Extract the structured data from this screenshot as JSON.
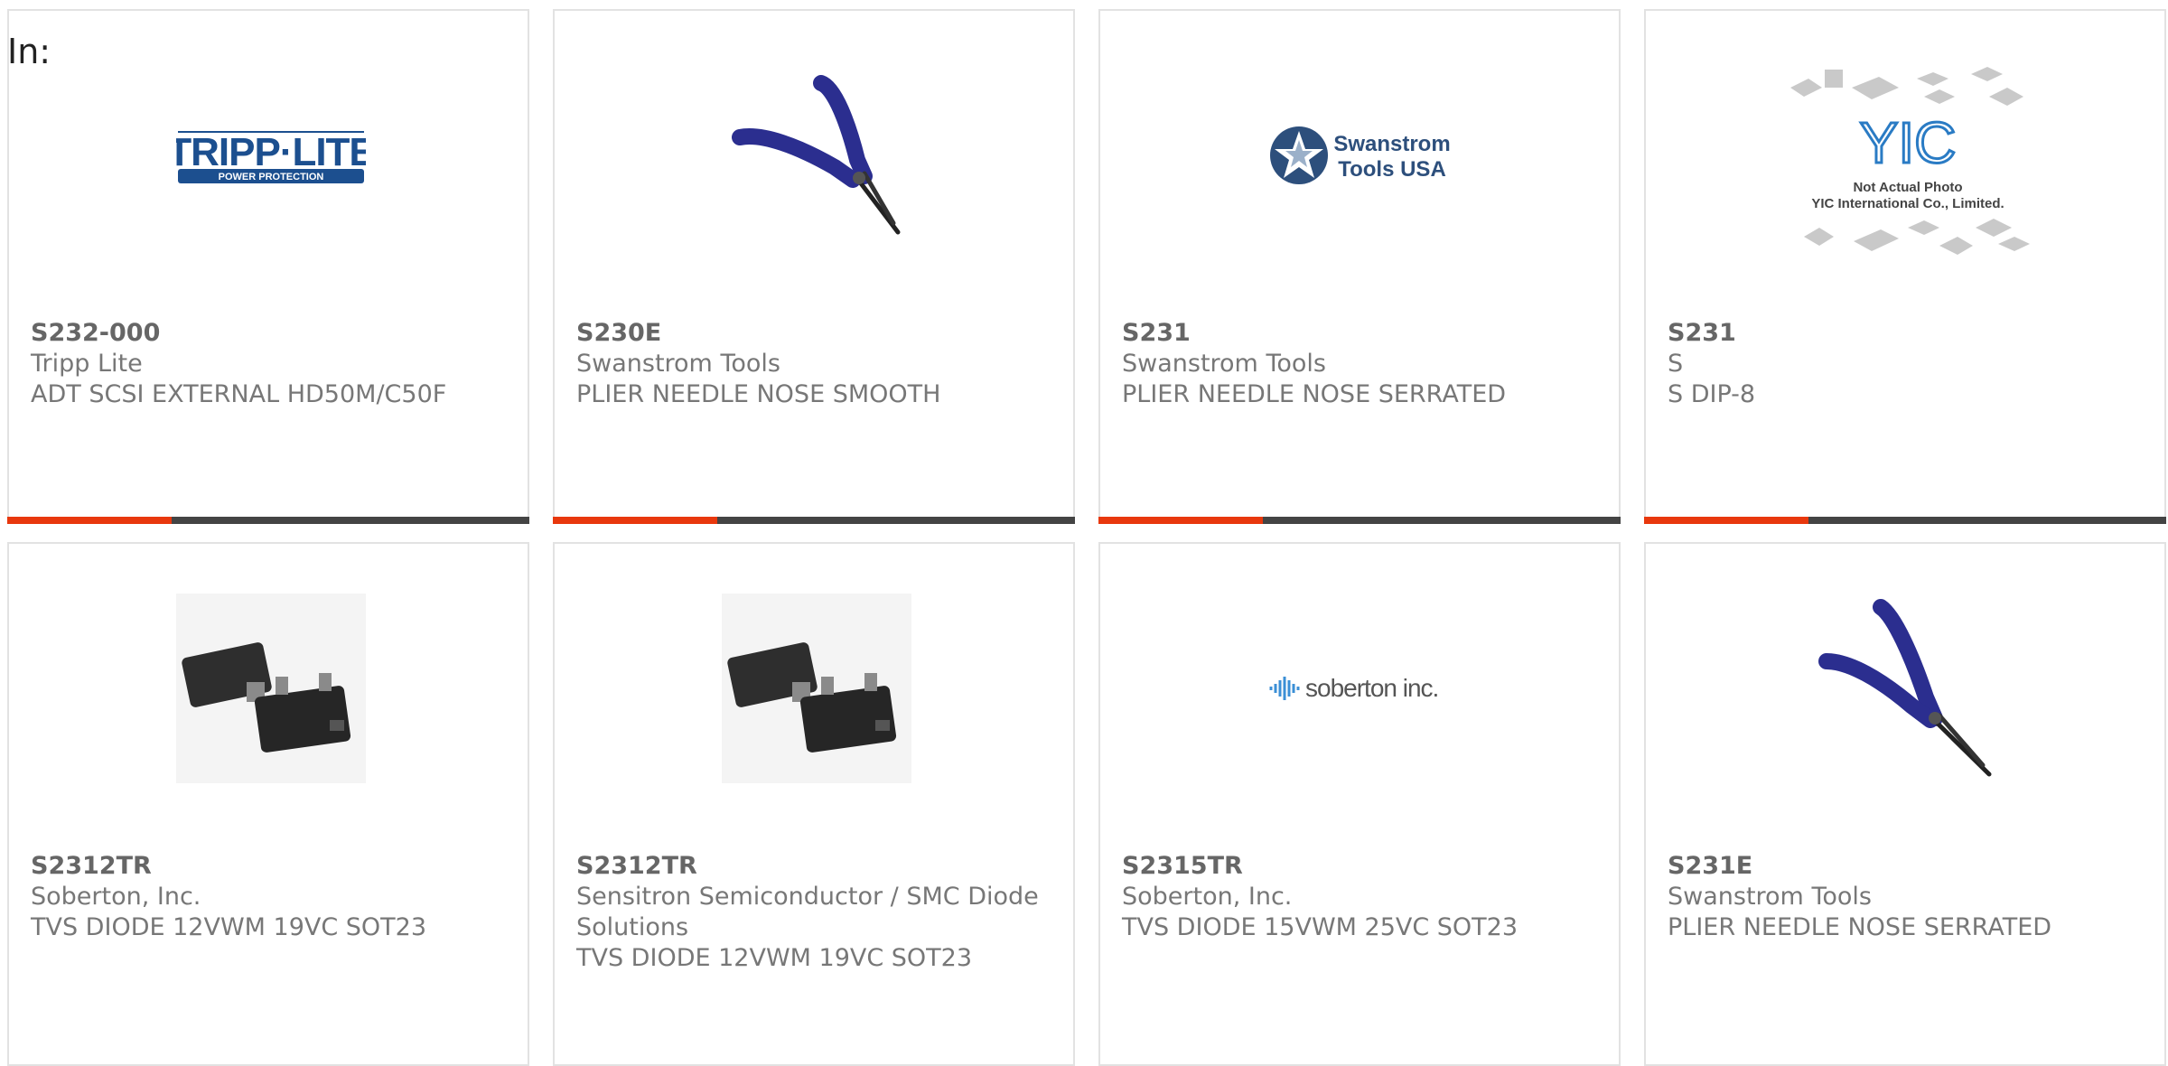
{
  "filter": {
    "label": "In:"
  },
  "colors": {
    "accent": "#e8380d",
    "bar": "#444444",
    "border": "#e2e2e2",
    "text": "#777777"
  },
  "products": [
    {
      "part_number": "S232-000",
      "manufacturer": "Tripp Lite",
      "description": "ADT SCSI EXTERNAL HD50M/C50F",
      "image": "tripp-lite-logo",
      "logo_text": "TRIPP·LITE",
      "logo_sub": "POWER PROTECTION"
    },
    {
      "part_number": "S230E",
      "manufacturer": "Swanstrom Tools",
      "description": "PLIER NEEDLE NOSE SMOOTH",
      "image": "needle-nose-plier-photo"
    },
    {
      "part_number": "S231",
      "manufacturer": "Swanstrom Tools",
      "description": "PLIER NEEDLE NOSE SERRATED",
      "image": "swanstrom-logo",
      "logo_text_1": "Swanstrom",
      "logo_text_2": "Tools USA"
    },
    {
      "part_number": "S231",
      "manufacturer": "S",
      "description": "S DIP-8",
      "image": "yic-placeholder",
      "logo_text": "YIC",
      "note_1": "Not Actual Photo",
      "note_2": "YIC International Co., Limited."
    },
    {
      "part_number": "S2312TR",
      "manufacturer": "Soberton, Inc.",
      "description": "TVS DIODE 12VWM 19VC SOT23",
      "image": "sot23-package-photo"
    },
    {
      "part_number": "S2312TR",
      "manufacturer": "Sensitron Semiconductor / SMC Diode Solutions",
      "description": "TVS DIODE 12VWM 19VC SOT23",
      "image": "sot23-package-photo"
    },
    {
      "part_number": "S2315TR",
      "manufacturer": "Soberton, Inc.",
      "description": "TVS DIODE 15VWM 25VC SOT23",
      "image": "soberton-logo",
      "logo_text": "soberton inc."
    },
    {
      "part_number": "S231E",
      "manufacturer": "Swanstrom Tools",
      "description": "PLIER NEEDLE NOSE SERRATED",
      "image": "needle-nose-plier-photo"
    }
  ]
}
